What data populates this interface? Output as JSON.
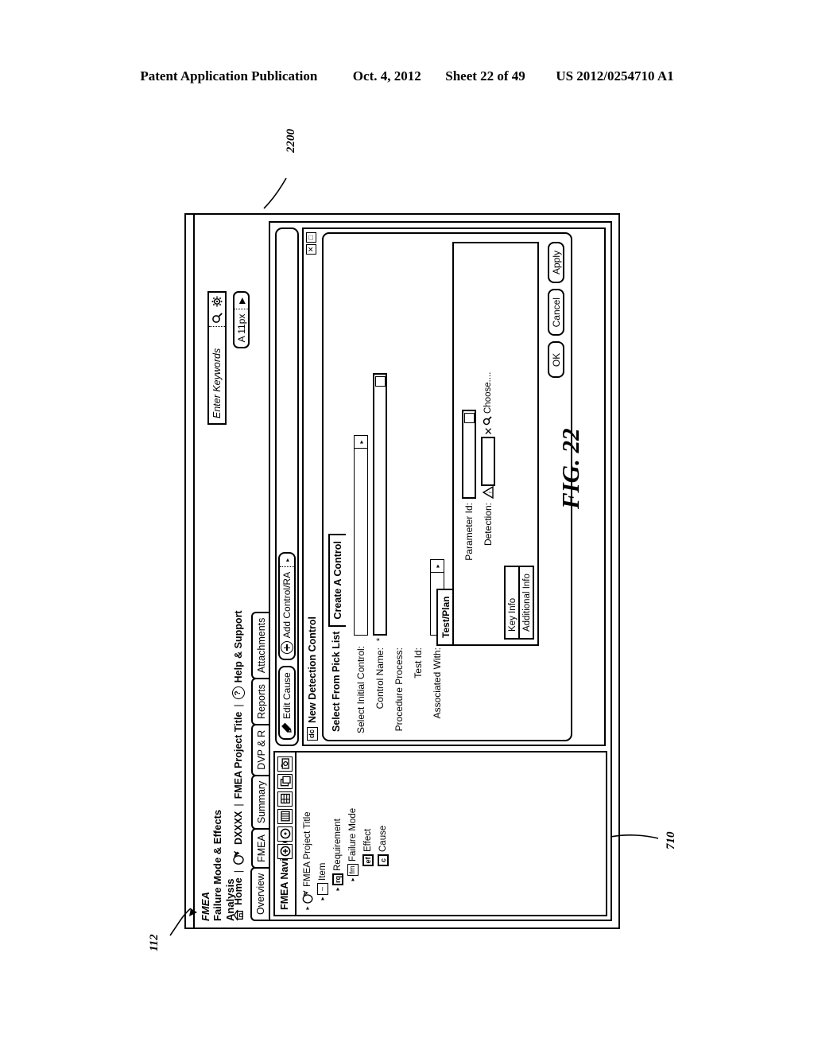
{
  "patent_header": {
    "publication": "Patent Application Publication",
    "date": "Oct. 4, 2012",
    "sheet": "Sheet 22 of 49",
    "number": "US 2012/0254710 A1"
  },
  "figure": {
    "caption": "FIG. 22",
    "ref_window": "2200",
    "ref_app": "112",
    "ref_navigator": "710"
  },
  "app": {
    "brand_line1": "FMEA",
    "brand_line2": "Failure Mode & Effects Analysis",
    "breadcrumb": [
      {
        "label": "Home",
        "icon": "home-icon"
      },
      {
        "label": "DXXXX",
        "icon": "hand-icon"
      },
      {
        "label": "FMEA Project Title",
        "icon": ""
      },
      {
        "label": "Help & Support",
        "icon": "question-circle-icon"
      }
    ],
    "search": {
      "placeholder": "Enter Keywords",
      "search_icon": "magnifier-icon",
      "settings_icon": "gear-icon"
    },
    "font_size": {
      "label": "A 11px",
      "arrow": "▸"
    },
    "tabs": [
      {
        "label": "Overview",
        "active": true
      },
      {
        "label": "FMEA",
        "active": false
      },
      {
        "label": "Summary",
        "active": false
      },
      {
        "label": "DVP & R",
        "active": false
      },
      {
        "label": "Reports",
        "active": false
      },
      {
        "label": "Attachments",
        "active": false
      }
    ]
  },
  "navigator": {
    "title": "FMEA Navigator",
    "tools": [
      {
        "name": "add-icon",
        "glyph": "⊕"
      },
      {
        "name": "remove-icon",
        "glyph": "⊙"
      },
      {
        "name": "columns-icon",
        "glyph": "‖"
      },
      {
        "name": "grid-icon",
        "glyph": "▦"
      },
      {
        "name": "copy-icon",
        "glyph": "⧉"
      },
      {
        "name": "camera-icon",
        "glyph": "▣"
      }
    ],
    "tree": [
      {
        "label": "FMEA Project Title",
        "tag": "",
        "depth": 0,
        "twisty": "▸"
      },
      {
        "label": "Item",
        "tag": "–",
        "depth": 1,
        "twisty": "▸"
      },
      {
        "label": "Requirement",
        "tag": "rq",
        "depth": 2,
        "twisty": "▸"
      },
      {
        "label": "Failure Mode",
        "tag": "fm",
        "depth": 3,
        "twisty": "▸"
      },
      {
        "label": "Effect",
        "tag": "ef",
        "depth": 4,
        "twisty": ""
      },
      {
        "label": "Cause",
        "tag": "c",
        "depth": 4,
        "twisty": ""
      }
    ]
  },
  "toolbar": {
    "edit_cause": "Edit Cause",
    "add_control": "Add Control/RA",
    "add_control_arrow": "▸"
  },
  "dialog": {
    "icon_label": "dc",
    "title": "New Detection Control",
    "window_buttons": [
      {
        "name": "maximize-restore-button",
        "glyph": "□"
      },
      {
        "name": "close-button",
        "glyph": "✕"
      }
    ],
    "tabs": [
      {
        "label": "Select From Pick List",
        "active": false
      },
      {
        "label": "Create A Control",
        "active": true
      }
    ],
    "fields": [
      {
        "label": "Select Initial Control:",
        "value": "",
        "required": false,
        "control": "dropdown"
      },
      {
        "label": "Control Name:",
        "value": "",
        "required": true,
        "control": "text-expand"
      },
      {
        "label": "Procedure Process:",
        "value": "",
        "required": false,
        "control": "none"
      },
      {
        "label": "Test Id:",
        "value": "",
        "required": false,
        "control": "none"
      },
      {
        "label": "Associated With:",
        "value": "",
        "required": false,
        "control": "dropdown"
      }
    ],
    "subpanel": {
      "tab": "Test/Plan",
      "vtabs": [
        {
          "label": "Key Info",
          "selected": true
        },
        {
          "label": "Additional Info",
          "selected": false
        }
      ],
      "param_label": "Parameter Id:",
      "param_value": "",
      "detection_label": "Detection:",
      "detection_value": "",
      "warn_icon": "warning-triangle-icon",
      "clear_icon": "x-icon",
      "choose_label": "Choose....",
      "choose_icon": "magnifier-icon"
    },
    "buttons": [
      {
        "label": "OK",
        "name": "ok-button"
      },
      {
        "label": "Cancel",
        "name": "cancel-button"
      },
      {
        "label": "Apply",
        "name": "apply-button"
      }
    ]
  }
}
